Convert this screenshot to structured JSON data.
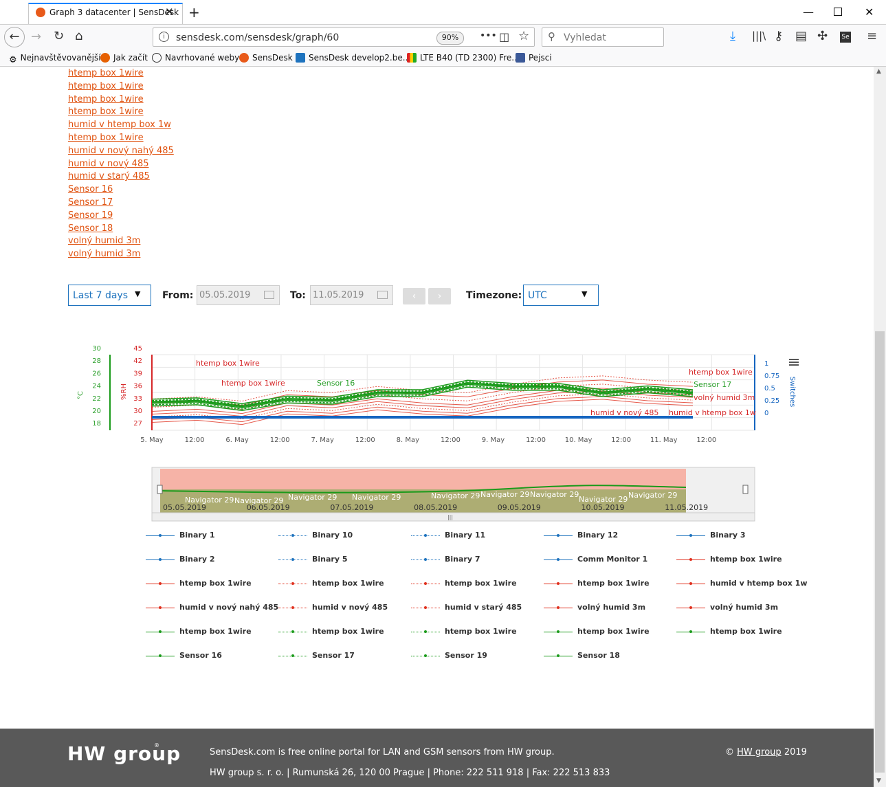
{
  "browser": {
    "tab_title": "Graph 3 datacenter | SensDesk",
    "url": "sensdesk.com/sensdesk/graph/60",
    "zoom": "90%",
    "search_placeholder": "Vyhledat",
    "bookmarks": [
      "Nejnavštěvovanější",
      "Jak začít",
      "Navrhované weby",
      "SensDesk",
      "SensDesk develop2.be...",
      "LTE B40 (TD 2300) Fre...",
      "Pejsci"
    ]
  },
  "sensor_links": [
    "htemp box 1wire",
    "htemp box 1wire",
    "htemp box 1wire",
    "htemp box 1wire",
    "humid v htemp box 1w",
    "htemp box 1wire",
    "humid v nový nahý 485",
    "humid v nový 485",
    "humid v starý 485",
    "Sensor 16",
    "Sensor 17",
    "Sensor 19",
    "Sensor 18",
    "volný humid 3m",
    "volný humid 3m"
  ],
  "controls": {
    "range": "Last 7 days",
    "from_label": "From:",
    "from_value": "05.05.2019",
    "to_label": "To:",
    "to_value": "11.05.2019",
    "prev": "‹",
    "next": "›",
    "tz_label": "Timezone:",
    "tz_value": "UTC"
  },
  "chart_data": {
    "type": "line",
    "y_axes": [
      {
        "unit": "°C",
        "color": "#2ca02c",
        "ticks": [
          "30",
          "28",
          "26",
          "24",
          "22",
          "20",
          "18"
        ]
      },
      {
        "unit": "%RH",
        "color": "#d62728",
        "ticks": [
          "45",
          "42",
          "39",
          "36",
          "33",
          "30",
          "27"
        ]
      },
      {
        "unit": "Switches",
        "color": "#1565c0",
        "ticks": [
          "1",
          "0.75",
          "0.5",
          "0.25",
          "0"
        ]
      }
    ],
    "x_ticks": [
      "5. May",
      "12:00",
      "6. May",
      "12:00",
      "7. May",
      "12:00",
      "8. May",
      "12:00",
      "9. May",
      "12:00",
      "10. May",
      "12:00",
      "11. May",
      "12:00"
    ],
    "annotations": [
      {
        "text": "htemp box 1wire",
        "color": "#d62728"
      },
      {
        "text": "htemp box 1wire",
        "color": "#d62728"
      },
      {
        "text": "Sensor 16",
        "color": "#2ca02c"
      },
      {
        "text": "htemp box 1wire",
        "color": "#d62728"
      },
      {
        "text": "Sensor 17",
        "color": "#2ca02c"
      },
      {
        "text": "volný humid 3m",
        "color": "#d62728"
      },
      {
        "text": "humid v nový 485",
        "color": "#d62728"
      },
      {
        "text": "humid v htemp box 1w",
        "color": "#d62728"
      }
    ],
    "series_sample": {
      "red_humidity_rh": [
        31.5,
        32.0,
        31.0,
        33.5,
        33.0,
        34.5,
        33.5,
        33.0,
        35.0,
        36.5,
        37.0,
        36.0,
        35.5
      ],
      "green_temperature_c": [
        22.5,
        22.7,
        21.8,
        23.0,
        22.8,
        24.0,
        24.0,
        25.5,
        25.0,
        25.0,
        24.0,
        24.6,
        24.0
      ],
      "blue_switches": [
        0,
        0,
        0,
        0,
        0,
        0,
        0,
        0,
        0,
        0,
        0,
        0,
        0
      ]
    },
    "navigator": {
      "labels": [
        "Navigator 29",
        "Navigator 29",
        "Navigator 29",
        "Navigator 29",
        "Navigator 29",
        "Navigator 29",
        "Navigator 29",
        "Navigator 29",
        "Navigator 29"
      ],
      "dates": [
        "05.05.2019",
        "06.05.2019",
        "07.05.2019",
        "08.05.2019",
        "09.05.2019",
        "10.05.2019",
        "11.05.2019"
      ]
    }
  },
  "legend": [
    {
      "label": "Binary 1",
      "color": "#1e73be"
    },
    {
      "label": "Binary 10",
      "color": "#1e73be"
    },
    {
      "label": "Binary 11",
      "color": "#1e73be"
    },
    {
      "label": "Binary 12",
      "color": "#1e73be"
    },
    {
      "label": "Binary 3",
      "color": "#1e73be"
    },
    {
      "label": "Binary 2",
      "color": "#1e73be"
    },
    {
      "label": "Binary 5",
      "color": "#1e73be"
    },
    {
      "label": "Binary 7",
      "color": "#1e73be"
    },
    {
      "label": "Comm Monitor 1",
      "color": "#1e73be"
    },
    {
      "label": "htemp box 1wire",
      "color": "#e0301e"
    },
    {
      "label": "htemp box 1wire",
      "color": "#e0301e"
    },
    {
      "label": "htemp box 1wire",
      "color": "#e0301e"
    },
    {
      "label": "htemp box 1wire",
      "color": "#e0301e"
    },
    {
      "label": "htemp box 1wire",
      "color": "#e0301e"
    },
    {
      "label": "humid v htemp box 1w",
      "color": "#e0301e"
    },
    {
      "label": "humid v nový nahý 485",
      "color": "#e0301e"
    },
    {
      "label": "humid v nový 485",
      "color": "#e0301e"
    },
    {
      "label": "humid v starý 485",
      "color": "#e0301e"
    },
    {
      "label": "volný humid 3m",
      "color": "#e0301e"
    },
    {
      "label": "volný humid 3m",
      "color": "#e0301e"
    },
    {
      "label": "htemp box 1wire",
      "color": "#1a9a1a"
    },
    {
      "label": "htemp box 1wire",
      "color": "#1a9a1a"
    },
    {
      "label": "htemp box 1wire",
      "color": "#1a9a1a"
    },
    {
      "label": "htemp box 1wire",
      "color": "#1a9a1a"
    },
    {
      "label": "htemp box 1wire",
      "color": "#1a9a1a"
    },
    {
      "label": "Sensor 16",
      "color": "#1a9a1a"
    },
    {
      "label": "Sensor 17",
      "color": "#1a9a1a"
    },
    {
      "label": "Sensor 19",
      "color": "#1a9a1a"
    },
    {
      "label": "Sensor 18",
      "color": "#1a9a1a"
    }
  ],
  "footer": {
    "logo": "HW group",
    "line1": "SensDesk.com is free online portal for LAN and GSM sensors from HW group.",
    "line2": "HW group s. r. o. | Rumunská 26, 120 00 Prague | Phone: 222 511 918 | Fax: 222 513 833",
    "copyright_prefix": "©",
    "copyright_link": "HW group",
    "copyright_year": "2019"
  }
}
